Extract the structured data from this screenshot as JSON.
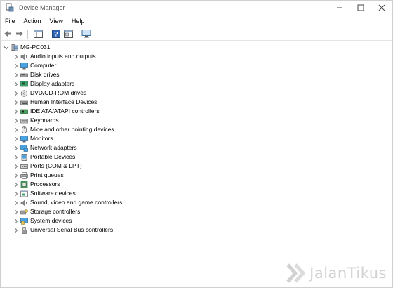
{
  "window": {
    "title": "Device Manager"
  },
  "menu": [
    "File",
    "Action",
    "View",
    "Help"
  ],
  "tree": {
    "root": "MG-PC031",
    "items": [
      {
        "label": "Audio inputs and outputs",
        "icon": "speaker-icon"
      },
      {
        "label": "Computer",
        "icon": "computer-icon"
      },
      {
        "label": "Disk drives",
        "icon": "disk-drive-icon"
      },
      {
        "label": "Display adapters",
        "icon": "display-adapter-icon"
      },
      {
        "label": "DVD/CD-ROM drives",
        "icon": "dvd-drive-icon"
      },
      {
        "label": "Human Interface Devices",
        "icon": "hid-icon"
      },
      {
        "label": "IDE ATA/ATAPI controllers",
        "icon": "ide-controller-icon"
      },
      {
        "label": "Keyboards",
        "icon": "keyboard-icon"
      },
      {
        "label": "Mice and other pointing devices",
        "icon": "mouse-icon"
      },
      {
        "label": "Monitors",
        "icon": "monitor-icon"
      },
      {
        "label": "Network adapters",
        "icon": "network-adapter-icon"
      },
      {
        "label": "Portable Devices",
        "icon": "portable-device-icon"
      },
      {
        "label": "Ports (COM & LPT)",
        "icon": "port-icon"
      },
      {
        "label": "Print queues",
        "icon": "printer-icon"
      },
      {
        "label": "Processors",
        "icon": "processor-icon"
      },
      {
        "label": "Software devices",
        "icon": "software-device-icon"
      },
      {
        "label": "Sound, video and game controllers",
        "icon": "sound-controller-icon"
      },
      {
        "label": "Storage controllers",
        "icon": "storage-controller-icon"
      },
      {
        "label": "System devices",
        "icon": "system-device-icon"
      },
      {
        "label": "Universal Serial Bus controllers",
        "icon": "usb-icon"
      }
    ]
  },
  "watermark": {
    "text": "JalanTikus"
  }
}
